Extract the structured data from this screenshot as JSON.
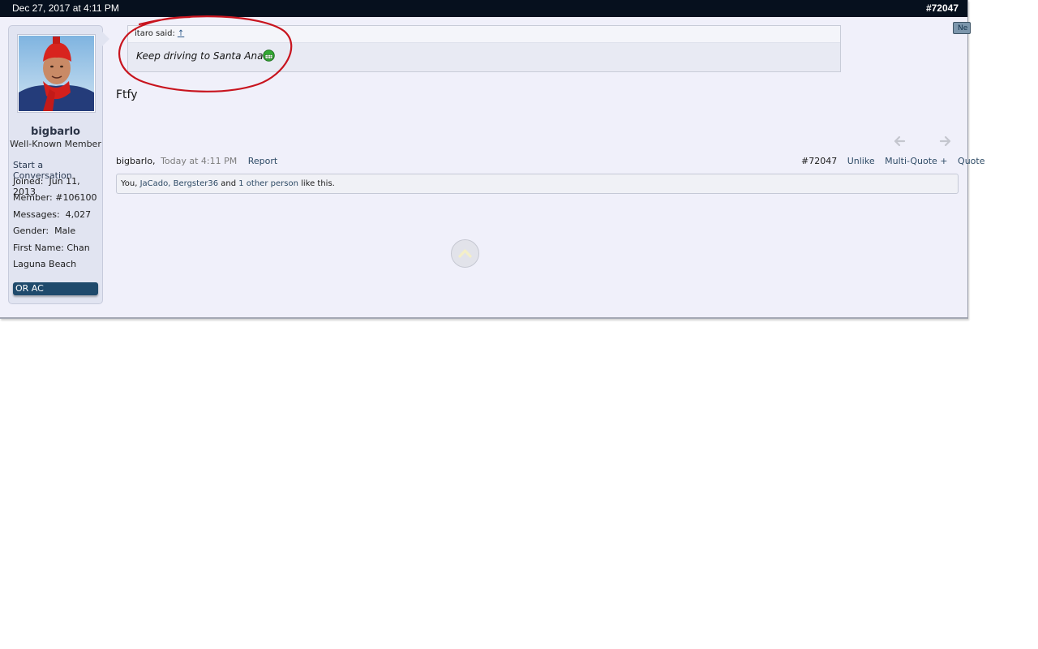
{
  "post": {
    "date": "Dec 27, 2017 at 4:11 PM",
    "number": "#72047",
    "new_button": "Ne",
    "message": "Ftfy"
  },
  "user": {
    "name": "bigbarlo",
    "title": "Well-Known Member",
    "start_conversation": "Start a Conversation",
    "fields": [
      {
        "label": "Joined:",
        "value": "Jun 11, 2013"
      },
      {
        "label": "Member:",
        "value": "#106100"
      },
      {
        "label": "Messages:",
        "value": "4,027"
      },
      {
        "label": "Gender:",
        "value": "Male"
      },
      {
        "label": "First Name:",
        "value": "Chan"
      }
    ],
    "location": "Laguna Beach",
    "badge": "OR AC"
  },
  "quote": {
    "author": "itaro said:",
    "up_link": "↑",
    "text": "Keep driving to Santa Ana",
    "emoji": "grin-smiley-icon"
  },
  "meta": {
    "author": "bigbarlo,",
    "time": "Today at 4:11 PM",
    "report": "Report"
  },
  "controls": {
    "post_number": "#72047",
    "unlike": "Unlike",
    "multi_quote": "Multi-Quote +",
    "quote": "Quote"
  },
  "likes": {
    "you": "You,",
    "user1": "JaCado,",
    "user2": "Bergster36",
    "and": "and",
    "others": "1 other person",
    "suffix": "like this."
  },
  "annotation_color": "#c8141e"
}
